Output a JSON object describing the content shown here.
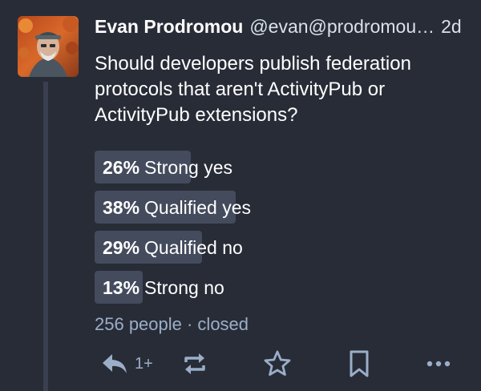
{
  "status": {
    "display_name": "Evan Prodromou",
    "handle": "@evan@prodromou…",
    "time": "2d",
    "content": "Should developers publish federation protocols that aren't ActivityPub or ActivityPub extensions?"
  },
  "poll": {
    "options": [
      {
        "percent": "26%",
        "label": "Strong yes",
        "value": 26
      },
      {
        "percent": "38%",
        "label": "Qualified yes",
        "value": 38
      },
      {
        "percent": "29%",
        "label": "Qualified no",
        "value": 29
      },
      {
        "percent": "13%",
        "label": "Strong no",
        "value": 13
      }
    ],
    "footer": "256 people · closed"
  },
  "actions": {
    "reply_count": "1+",
    "icons": [
      "reply-icon",
      "boost-icon",
      "favourite-icon",
      "bookmark-icon",
      "more-icon"
    ]
  },
  "colors": {
    "background": "#282c37",
    "poll_bar": "#444b5d",
    "muted": "#9baec8"
  }
}
